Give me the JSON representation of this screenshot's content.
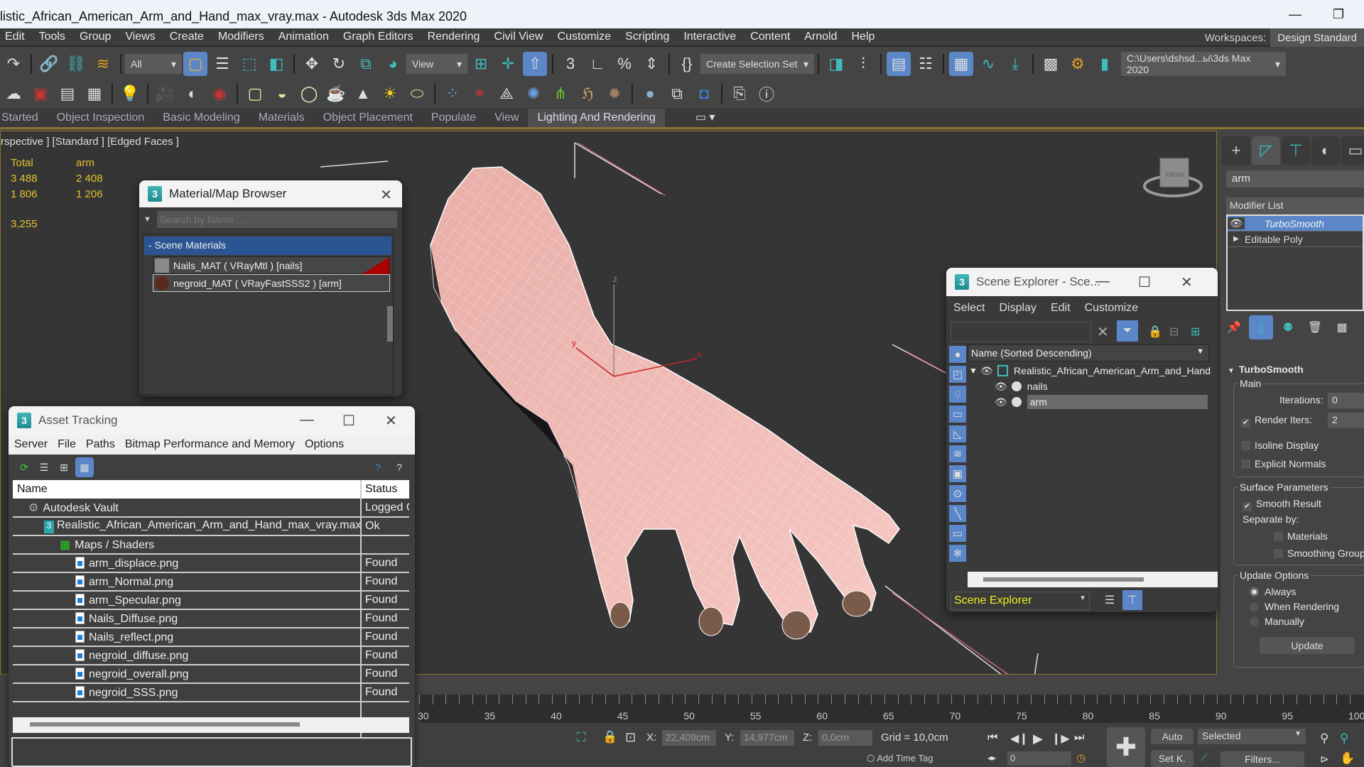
{
  "window": {
    "title": "listic_African_American_Arm_and_Hand_max_vray.max - Autodesk 3ds Max 2020",
    "minimize_glyph": "—",
    "restore_glyph": "❐"
  },
  "menubar": {
    "items": [
      "Edit",
      "Tools",
      "Group",
      "Views",
      "Create",
      "Modifiers",
      "Animation",
      "Graph Editors",
      "Rendering",
      "Civil View",
      "Customize",
      "Scripting",
      "Interactive",
      "Content",
      "Arnold",
      "Help"
    ],
    "workspaces_label": "Workspaces:",
    "workspace_value": "Design Standard"
  },
  "toolbar": {
    "selection_filter": "All",
    "reference_coord": "View",
    "named_selection": "Create Selection Set",
    "project_path": "C:\\Users\\dshsd...ы\\3ds Max 2020"
  },
  "ribbon": {
    "tabs": [
      "Started",
      "Object Inspection",
      "Basic Modeling",
      "Materials",
      "Object Placement",
      "Populate",
      "View",
      "Lighting And Rendering"
    ],
    "active_tab": "Lighting And Rendering"
  },
  "viewport": {
    "label": "rspective ] [Standard ] [Edged Faces ]",
    "stats": {
      "col_total": "Total",
      "col_selected": "arm",
      "polys_total": "3 488",
      "polys_selected": "2 408",
      "verts_total": "1 806",
      "verts_selected": "1 206",
      "fps": "3,255"
    },
    "viewcube_face": "FRONT",
    "axis_labels": {
      "x": "x",
      "y": "y",
      "z": "z"
    }
  },
  "material_browser": {
    "title": "Material/Map Browser",
    "search_placeholder": "Search by Name ...",
    "group_label": "- Scene Materials",
    "materials": [
      {
        "name": "Nails_MAT  ( VRayMtl )  [nails]",
        "swatch": "#8a8a8a"
      },
      {
        "name": "negroid_MAT  ( VRayFastSSS2 )  [arm]",
        "swatch": "#5a2a1c"
      }
    ]
  },
  "asset_tracking": {
    "title": "Asset Tracking",
    "menu": [
      "Server",
      "File",
      "Paths",
      "Bitmap Performance and Memory",
      "Options"
    ],
    "columns": [
      "Name",
      "Status"
    ],
    "rows": [
      {
        "name": "Autodesk Vault",
        "status": "Logged O",
        "indent": 1,
        "icon": "vault-icon"
      },
      {
        "name": "Realistic_African_American_Arm_and_Hand_max_vray.max",
        "status": "Ok",
        "indent": 2,
        "icon": "max-file-icon"
      },
      {
        "name": "Maps / Shaders",
        "status": "",
        "indent": 3,
        "icon": "maps-icon"
      },
      {
        "name": "arm_displace.png",
        "status": "Found",
        "indent": 4,
        "icon": "image-file-icon"
      },
      {
        "name": "arm_Normal.png",
        "status": "Found",
        "indent": 4,
        "icon": "image-file-icon"
      },
      {
        "name": "arm_Specular.png",
        "status": "Found",
        "indent": 4,
        "icon": "image-file-icon"
      },
      {
        "name": "Nails_Diffuse.png",
        "status": "Found",
        "indent": 4,
        "icon": "image-file-icon"
      },
      {
        "name": "Nails_reflect.png",
        "status": "Found",
        "indent": 4,
        "icon": "image-file-icon"
      },
      {
        "name": "negroid_diffuse.png",
        "status": "Found",
        "indent": 4,
        "icon": "image-file-icon"
      },
      {
        "name": "negroid_overall.png",
        "status": "Found",
        "indent": 4,
        "icon": "image-file-icon"
      },
      {
        "name": "negroid_SSS.png",
        "status": "Found",
        "indent": 4,
        "icon": "image-file-icon"
      }
    ]
  },
  "scene_explorer": {
    "title": "Scene Explorer - Sce...",
    "menu": [
      "Select",
      "Display",
      "Edit",
      "Customize"
    ],
    "column_header": "Name (Sorted Descending)",
    "tree": [
      {
        "name": "Realistic_African_American_Arm_and_Hand",
        "level": 0
      },
      {
        "name": "nails",
        "level": 1
      },
      {
        "name": "arm",
        "level": 1,
        "selected": true
      }
    ],
    "explorer_select": "Scene Explorer"
  },
  "command_panel": {
    "object_name": "arm",
    "modifier_list_label": "Modifier List",
    "stack": [
      "TurboSmooth",
      "Editable Poly"
    ],
    "rollout_title": "TurboSmooth",
    "main_group": "Main",
    "iterations_label": "Iterations:",
    "iterations_value": "0",
    "render_iters_label": "Render Iters:",
    "render_iters_value": "2",
    "render_iters_checked": true,
    "isoline_label": "Isoline Display",
    "isoline_checked": false,
    "explicit_normals_label": "Explicit Normals",
    "explicit_normals_checked": false,
    "surface_group": "Surface Parameters",
    "smooth_result_label": "Smooth Result",
    "smooth_result_checked": true,
    "separate_by_label": "Separate by:",
    "materials_label": "Materials",
    "smoothing_groups_label": "Smoothing Groups",
    "update_group": "Update Options",
    "update_options": [
      "Always",
      "When Rendering",
      "Manually"
    ],
    "update_selected": "Always",
    "update_button": "Update"
  },
  "timeline": {
    "ticks": [
      30,
      35,
      40,
      45,
      50,
      55,
      60,
      65,
      70,
      75,
      80,
      85,
      90,
      95,
      100
    ]
  },
  "statusbar": {
    "x_label": "X:",
    "x_value": "22,409cm",
    "y_label": "Y:",
    "y_value": "14,977cm",
    "z_label": "Z:",
    "z_value": "0,0cm",
    "grid": "Grid = 10,0cm",
    "add_time_tag": "Add Time Tag",
    "frame": "0",
    "auto_key": "Auto",
    "set_key": "Set K.",
    "key_filter": "Selected",
    "filters": "Filters..."
  }
}
